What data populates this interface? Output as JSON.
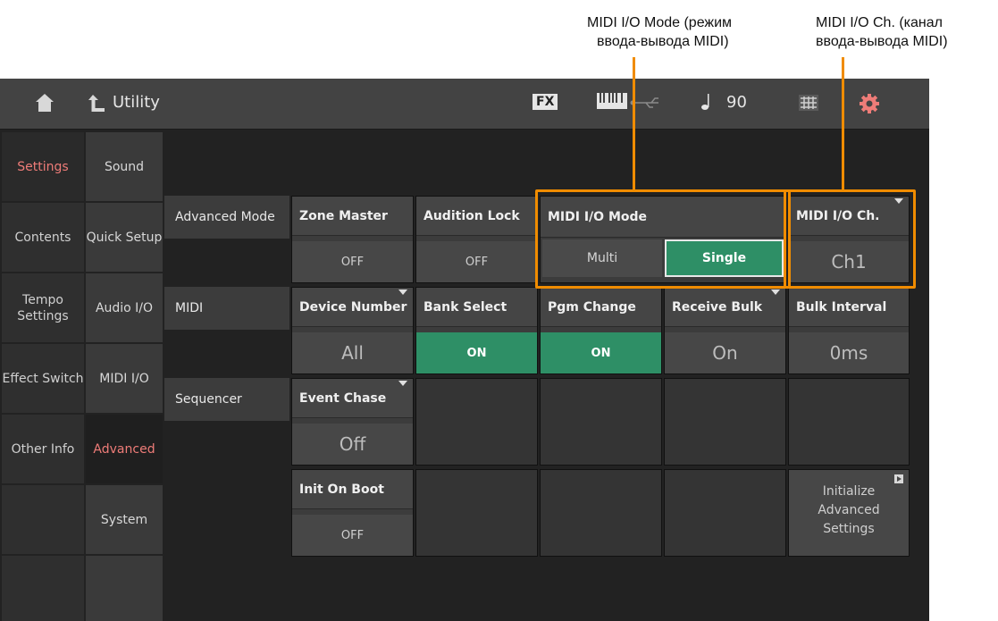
{
  "annotations": {
    "io_mode_line1": "MIDI I/O Mode (режим",
    "io_mode_line2": "ввода-вывода MIDI)",
    "io_ch_line1": "MIDI I/O Ch. (канал",
    "io_ch_line2": "ввода-вывода MIDI)",
    "highlight_color": "#f08c00"
  },
  "topbar": {
    "home_icon": "home-icon",
    "back_icon": "back-arrow-icon",
    "title": "Utility",
    "fx_label": "FX",
    "keyboard_icon": "keyboard-icon",
    "usb_icon": "usb-icon",
    "tempo_icon": "quarter-note-icon",
    "tempo_value": "90",
    "grid_icon": "grid-icon",
    "settings_icon": "gear-icon"
  },
  "left_tabs": [
    {
      "label": "Settings",
      "selected": true
    },
    {
      "label": "Contents"
    },
    {
      "label": "Tempo Settings"
    },
    {
      "label": "Effect Switch"
    },
    {
      "label": "Other Info"
    }
  ],
  "sub_tabs": [
    {
      "label": "Sound"
    },
    {
      "label": "Quick Setup"
    },
    {
      "label": "Audio I/O"
    },
    {
      "label": "MIDI I/O"
    },
    {
      "label": "Advanced",
      "selected": true
    },
    {
      "label": "System"
    }
  ],
  "rows": {
    "advanced_mode": "Advanced Mode",
    "midi": "MIDI",
    "sequencer": "Sequencer"
  },
  "cells": {
    "zone_master": {
      "title": "Zone Master",
      "value": "OFF"
    },
    "audition_lock": {
      "title": "Audition Lock",
      "value": "OFF"
    },
    "midi_io_mode": {
      "title": "MIDI I/O Mode",
      "option_multi": "Multi",
      "option_single": "Single",
      "selected": "Single"
    },
    "midi_io_ch": {
      "title": "MIDI I/O Ch.",
      "value": "Ch1"
    },
    "device_number": {
      "title": "Device Number",
      "value": "All"
    },
    "bank_select": {
      "title": "Bank Select",
      "value": "ON"
    },
    "pgm_change": {
      "title": "Pgm Change",
      "value": "ON"
    },
    "receive_bulk": {
      "title": "Receive Bulk",
      "value": "On"
    },
    "bulk_interval": {
      "title": "Bulk Interval",
      "value": "0ms"
    },
    "event_chase": {
      "title": "Event Chase",
      "value": "Off"
    },
    "init_on_boot": {
      "title": "Init On Boot",
      "value": "OFF"
    },
    "initialize": {
      "line1": "Initialize",
      "line2": "Advanced",
      "line3": "Settings"
    }
  },
  "colors": {
    "on_green": "#2e8f66",
    "selected_tab_text": "#ee7c78",
    "gear": "#ee7c78"
  }
}
